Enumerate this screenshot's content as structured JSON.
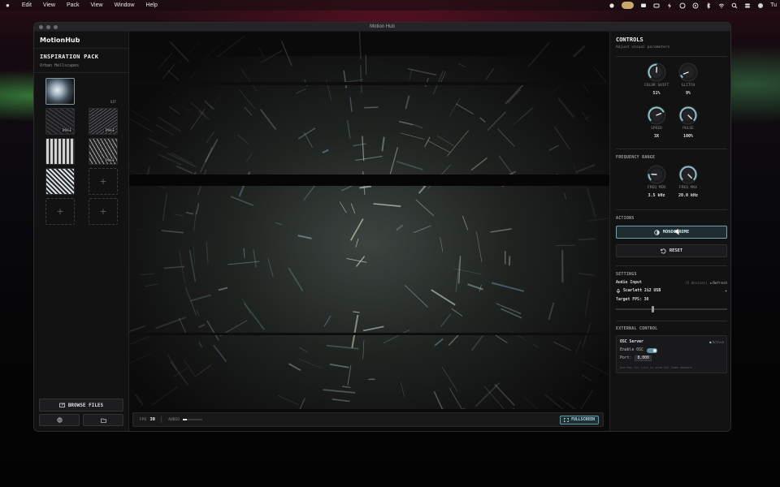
{
  "menubar": {
    "app_menus": [
      "Edit",
      "View",
      "Pack",
      "View",
      "Window",
      "Help"
    ],
    "clock_partial": "Tu"
  },
  "window": {
    "title": "Motion Hub"
  },
  "sidebar": {
    "logo": "MotionHub",
    "pack_title": "INSPIRATION PACK",
    "pack_subtitle": "Urban Hellscapes",
    "thumbnails": [
      {
        "kind": "image",
        "tag": ""
      },
      {
        "kind": "blank",
        "tag": "GIF"
      },
      {
        "kind": "image",
        "tag": "IMAGE"
      },
      {
        "kind": "image",
        "tag": "IMAGE"
      },
      {
        "kind": "image",
        "tag": ""
      },
      {
        "kind": "image",
        "tag": "IMAGE"
      },
      {
        "kind": "image",
        "tag": ""
      },
      {
        "kind": "empty",
        "tag": "+"
      },
      {
        "kind": "empty",
        "tag": "+"
      },
      {
        "kind": "empty",
        "tag": "+"
      }
    ],
    "browse_label": "BROWSE FILES"
  },
  "stage": {
    "fps_label": "FPS",
    "fps_value": "30",
    "audio_label": "AUDIO",
    "audio_level": 0.2,
    "fullscreen_label": "FULLSCREEN"
  },
  "panel": {
    "title": "CONTROLS",
    "subtitle": "Adjust visual parameters",
    "knobs_top": [
      {
        "label": "COLOR SHIFT",
        "value": "51%"
      },
      {
        "label": "GLITCH",
        "value": "9%"
      },
      {
        "label": "SPEED",
        "value": "3X"
      },
      {
        "label": "PULSE",
        "value": "100%"
      }
    ],
    "frequency_title": "FREQUENCY RANGE",
    "knobs_freq": [
      {
        "label": "FREQ MIN",
        "value": "3.5 kHz"
      },
      {
        "label": "FREQ MAX",
        "value": "20.0 kHz"
      }
    ],
    "actions_title": "ACTIONS",
    "monochrome_label": "MONOCHROME",
    "reset_label": "RESET",
    "settings_title": "SETTINGS",
    "audio_input_label": "Audio Input",
    "devices_count": "(5 devices)",
    "refresh_label": "Refresh",
    "device_selected": "Scarlett 2i2 USB",
    "target_fps_label": "Target FPS: 30",
    "target_fps_fraction": 0.33,
    "external_title": "EXTERNAL CONTROL",
    "osc_title": "OSC Server",
    "osc_status": "Active",
    "enable_osc_label": "Enable OSC",
    "port_label": "Port:",
    "port_value": "8,000",
    "osc_hint": "Use Max for Live to send OSC Comm daemons"
  },
  "colors": {
    "accent": "#6fa3ad",
    "background": "#0e0e0f",
    "panel": "#121213"
  }
}
